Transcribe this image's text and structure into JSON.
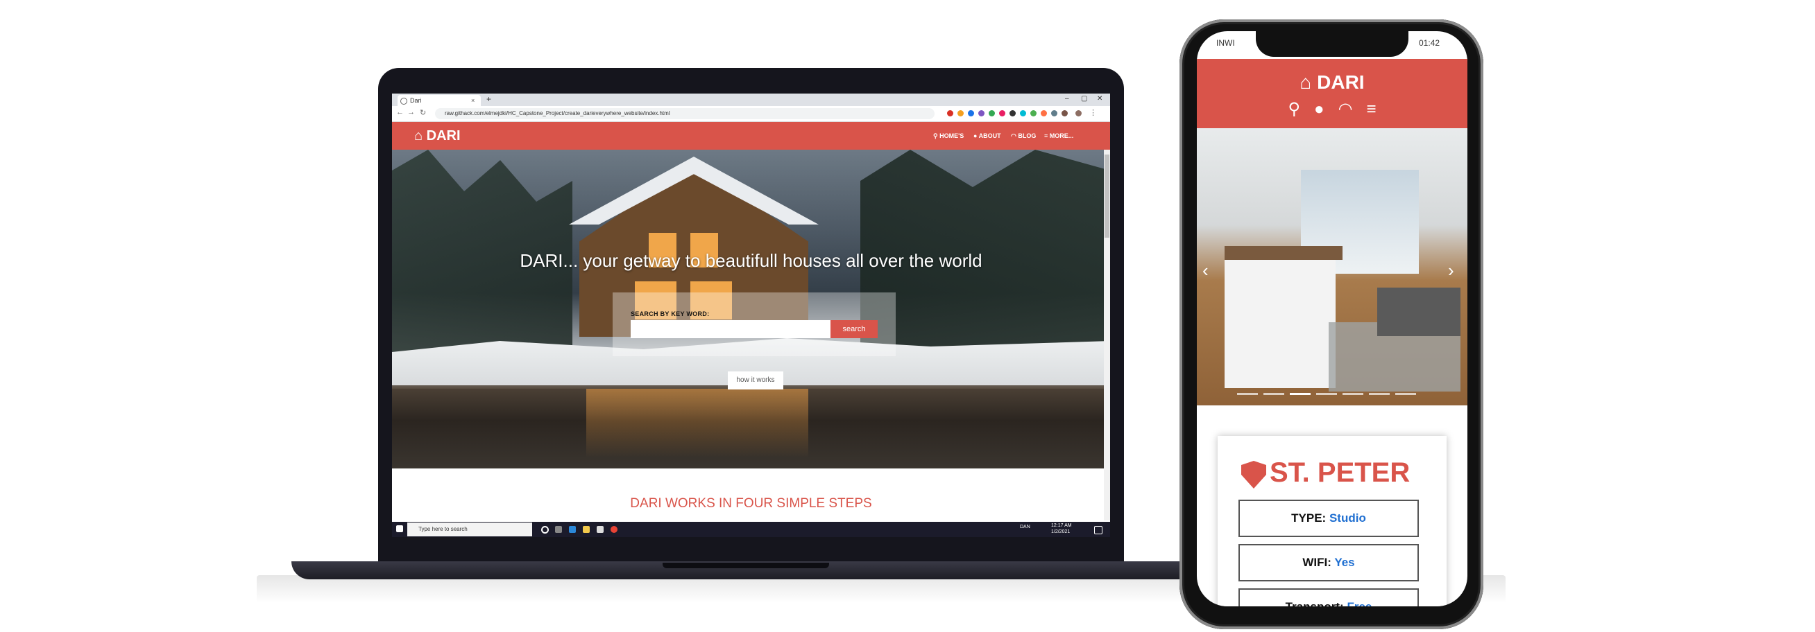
{
  "laptop": {
    "browser": {
      "tab_title": "Dari",
      "tab_close": "×",
      "new_tab": "+",
      "url": "raw.githack.com/elmejdki/HC_Capstone_Project/create_darieverywhere_website/index.html",
      "window_controls": [
        "–",
        "▢",
        "✕"
      ]
    },
    "site": {
      "logo": "DARI",
      "nav": [
        {
          "label": "HOME'S",
          "icon": "search-icon"
        },
        {
          "label": "ABOUT",
          "icon": "user-icon"
        },
        {
          "label": "BLOG",
          "icon": "rss-icon"
        },
        {
          "label": "MORE...",
          "icon": "menu-icon"
        }
      ],
      "headline": "DARI... your getway to beautifull houses all over the world",
      "search_label": "SEARCH BY KEY WORD:",
      "search_button": "search",
      "how_button": "how it works",
      "steps_title": "DARI WORKS IN FOUR SIMPLE STEPS"
    },
    "taskbar": {
      "search_placeholder": "Type here to search",
      "language": "DAN",
      "time": "12:17 AM",
      "date": "1/2/2021"
    }
  },
  "phone": {
    "status": {
      "carrier": "INWI",
      "battery_time": "01:42"
    },
    "logo": "DARI",
    "card": {
      "title": "ST. PETER",
      "fields": [
        {
          "label": "TYPE:",
          "value": "Studio"
        },
        {
          "label": "WIFI:",
          "value": "Yes"
        },
        {
          "label": "Transport:",
          "value": "Free"
        }
      ]
    },
    "slider": {
      "total": 7,
      "active": 3
    }
  },
  "colors": {
    "brand": "#d9544a",
    "value_blue": "#1f6fd1"
  }
}
